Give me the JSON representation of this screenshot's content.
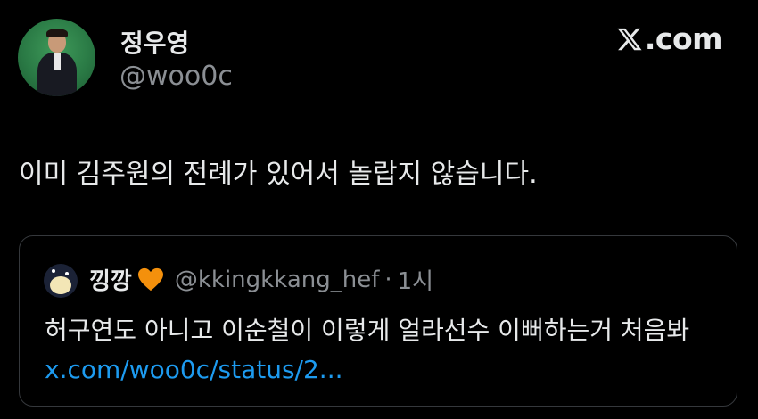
{
  "tweet": {
    "author": {
      "display_name": "정우영",
      "handle": "@woo0c"
    },
    "brand": {
      "label": ".com",
      "icon": "x-logo-icon"
    },
    "text": "이미 김주원의 전례가 있어서 놀랍지 않습니다."
  },
  "quoted_tweet": {
    "author": {
      "display_name": "낑깡",
      "emoji_icon": "orange-heart-icon",
      "handle": "@kkingkkang_hef",
      "separator": "·",
      "time": "1시"
    },
    "text": "허구연도 아니고 이순철이 이렇게 얼라선수 이뻐하는거 처음봐",
    "link_text": "x.com/woo0c/status/2..."
  },
  "colors": {
    "background": "#000000",
    "primary_text": "#e7e9ea",
    "secondary_text": "#8b8f94",
    "link": "#1d9bf0",
    "card_border": "#35383c",
    "heart": "#f4900c"
  }
}
